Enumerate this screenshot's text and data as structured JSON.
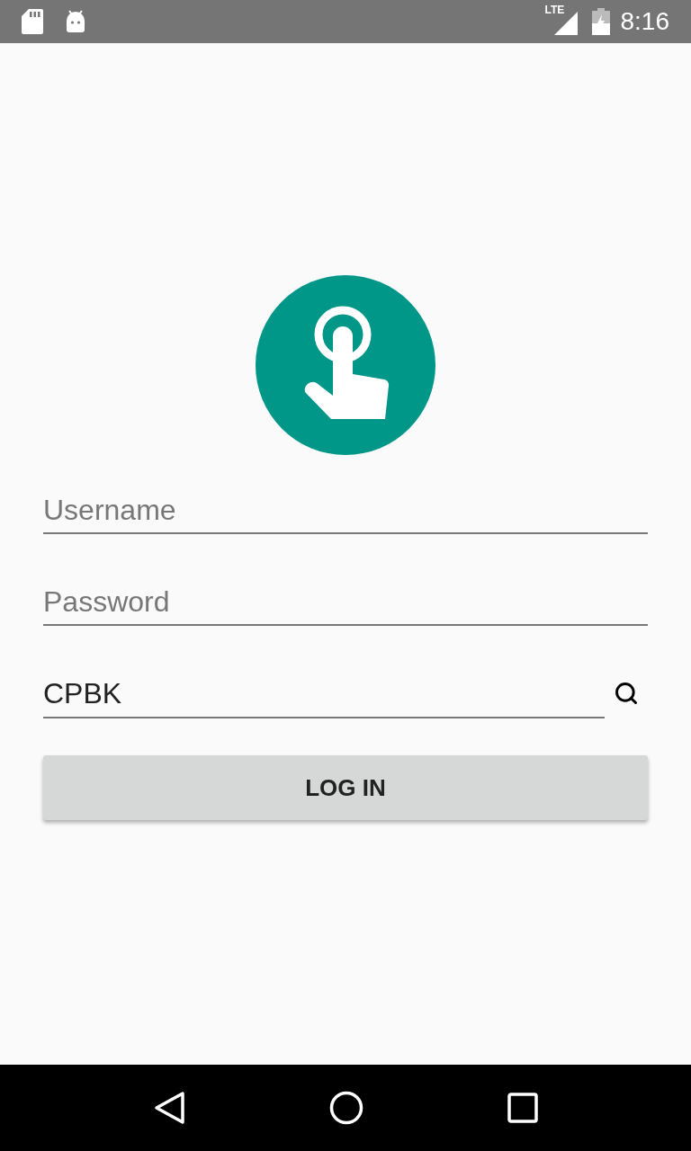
{
  "status_bar": {
    "network": "LTE",
    "time": "8:16"
  },
  "form": {
    "username": {
      "placeholder": "Username"
    },
    "password": {
      "placeholder": "Password"
    },
    "company": {
      "value": "CPBK"
    },
    "login_button": "LOG IN"
  }
}
